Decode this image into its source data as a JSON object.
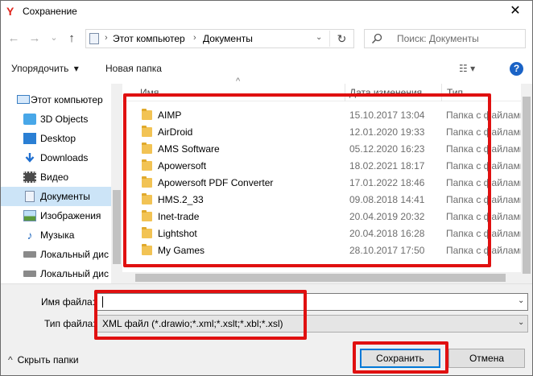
{
  "window": {
    "title": "Сохранение",
    "app_icon": "Y",
    "close_glyph": "✕"
  },
  "navbar": {
    "back_glyph": "←",
    "forward_glyph": "→",
    "dropdown_glyph": "⌄",
    "up_glyph": "↑",
    "breadcrumb": [
      "Этот компьютер",
      "Документы"
    ],
    "breadcrumb_separator": "›",
    "refresh_glyph": "↻",
    "search_placeholder": "Поиск: Документы"
  },
  "toolbar": {
    "organize_label": "Упорядочить",
    "organize_arrow": "▾",
    "new_folder_label": "Новая папка",
    "view_glyph": "☷ ▾",
    "help_glyph": "?"
  },
  "sidebar": {
    "items": [
      {
        "label": "Этот компьютер",
        "icon": "computer-icon"
      },
      {
        "label": "3D Objects",
        "icon": "3d-objects-icon"
      },
      {
        "label": "Desktop",
        "icon": "desktop-icon"
      },
      {
        "label": "Downloads",
        "icon": "downloads-icon"
      },
      {
        "label": "Видео",
        "icon": "video-icon"
      },
      {
        "label": "Документы",
        "icon": "documents-icon",
        "selected": true
      },
      {
        "label": "Изображения",
        "icon": "pictures-icon"
      },
      {
        "label": "Музыка",
        "icon": "music-icon"
      },
      {
        "label": "Локальный дис",
        "icon": "drive-icon"
      },
      {
        "label": "Локальный дис",
        "icon": "drive-icon"
      }
    ]
  },
  "file_list": {
    "columns": {
      "name": "Имя",
      "date": "Дата изменения",
      "type": "Тип"
    },
    "sort_glyph": "^",
    "rows": [
      {
        "name": "AIMP",
        "date": "15.10.2017 13:04",
        "type": "Папка с файлами"
      },
      {
        "name": "AirDroid",
        "date": "12.01.2020 19:33",
        "type": "Папка с файлами"
      },
      {
        "name": "AMS Software",
        "date": "05.12.2020 16:23",
        "type": "Папка с файлами"
      },
      {
        "name": "Apowersoft",
        "date": "18.02.2021 18:17",
        "type": "Папка с файлами"
      },
      {
        "name": "Apowersoft PDF Converter",
        "date": "17.01.2022 18:46",
        "type": "Папка с файлами"
      },
      {
        "name": "HMS.2_33",
        "date": "09.08.2018 14:41",
        "type": "Папка с файлами"
      },
      {
        "name": "Inet-trade",
        "date": "20.04.2019 20:32",
        "type": "Папка с файлами"
      },
      {
        "name": "Lightshot",
        "date": "20.04.2018 16:28",
        "type": "Папка с файлами"
      },
      {
        "name": "My Games",
        "date": "28.10.2017 17:50",
        "type": "Папка с файлами"
      }
    ]
  },
  "form": {
    "filename_label": "Имя файла:",
    "filename_value": "",
    "filetype_label": "Тип файла:",
    "filetype_value": "XML файл (*.drawio;*.xml;*.xslt;*.xbl;*.xsl)",
    "dropdown_glyph": "⌄"
  },
  "footer": {
    "hide_folders_glyph": "^",
    "hide_folders_label": "Скрыть папки",
    "save_label": "Сохранить",
    "cancel_label": "Отмена"
  },
  "annotation_color": "#e01010",
  "accent_color": "#0078d7"
}
